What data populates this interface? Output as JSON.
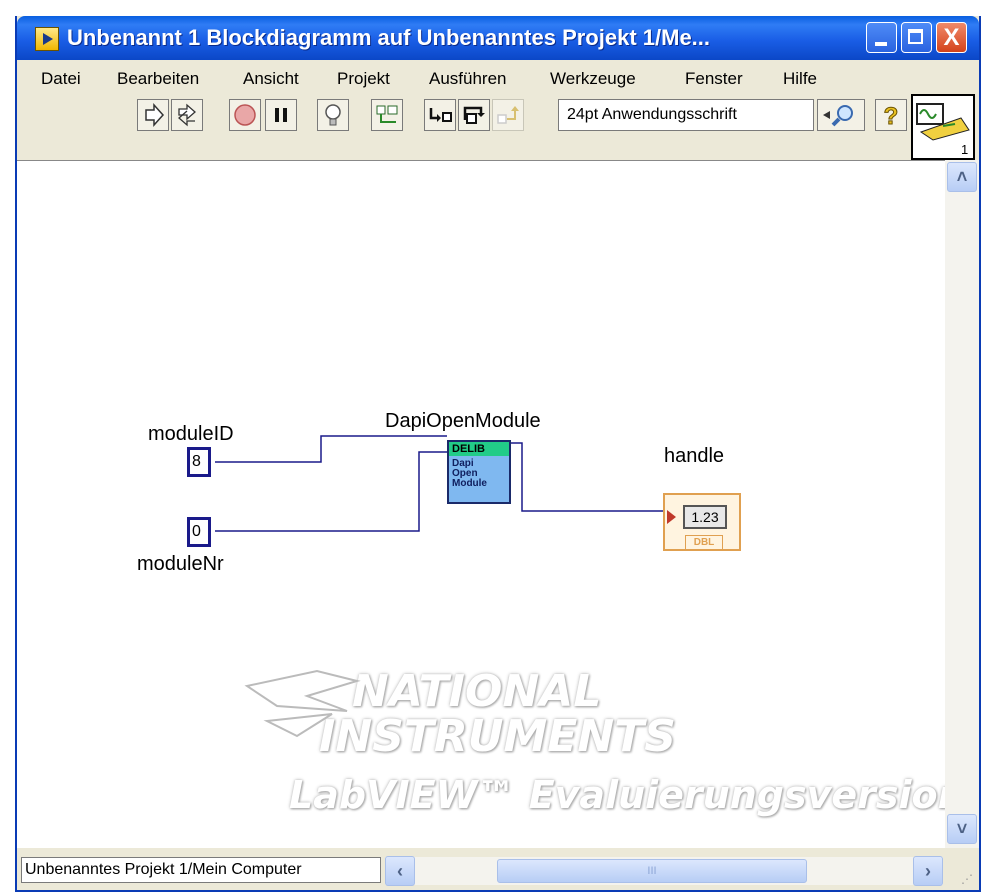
{
  "window": {
    "title": "Unbenannt 1 Blockdiagramm auf Unbenanntes Projekt 1/Me...",
    "close_glyph": "X"
  },
  "menu": [
    "Datei",
    "Bearbeiten",
    "Ansicht",
    "Projekt",
    "Ausführen",
    "Werkzeuge",
    "Fenster",
    "Hilfe"
  ],
  "toolbar": {
    "font": "24pt Anwendungsschrift",
    "icons": [
      "run-arrow-icon",
      "run-continuously-icon",
      "abort-icon",
      "pause-icon",
      "highlight-execution-icon",
      "retain-wire-values-icon",
      "step-into-icon",
      "step-over-icon",
      "step-out-icon",
      "font-dropdown-arrow-icon",
      "search-icon",
      "help-icon"
    ]
  },
  "diagram": {
    "constants": [
      {
        "label": "moduleID",
        "value": "8"
      },
      {
        "label": "moduleNr",
        "value": "0"
      }
    ],
    "subvi": {
      "label": "DapiOpenModule",
      "header": "DELIB",
      "body": "Dapi\nOpen\nModule"
    },
    "indicator": {
      "label": "handle",
      "value": "1.23",
      "type": "DBL"
    }
  },
  "watermark": {
    "line1": "NATIONAL",
    "line2": "INSTRUMENTS",
    "line3": "LabVIEW™ Evaluierungsversion"
  },
  "statusbar": {
    "path": "Unbenanntes Projekt 1/Mein Computer",
    "scroll_grip": "III"
  },
  "vi_icon": {
    "number": "1"
  }
}
